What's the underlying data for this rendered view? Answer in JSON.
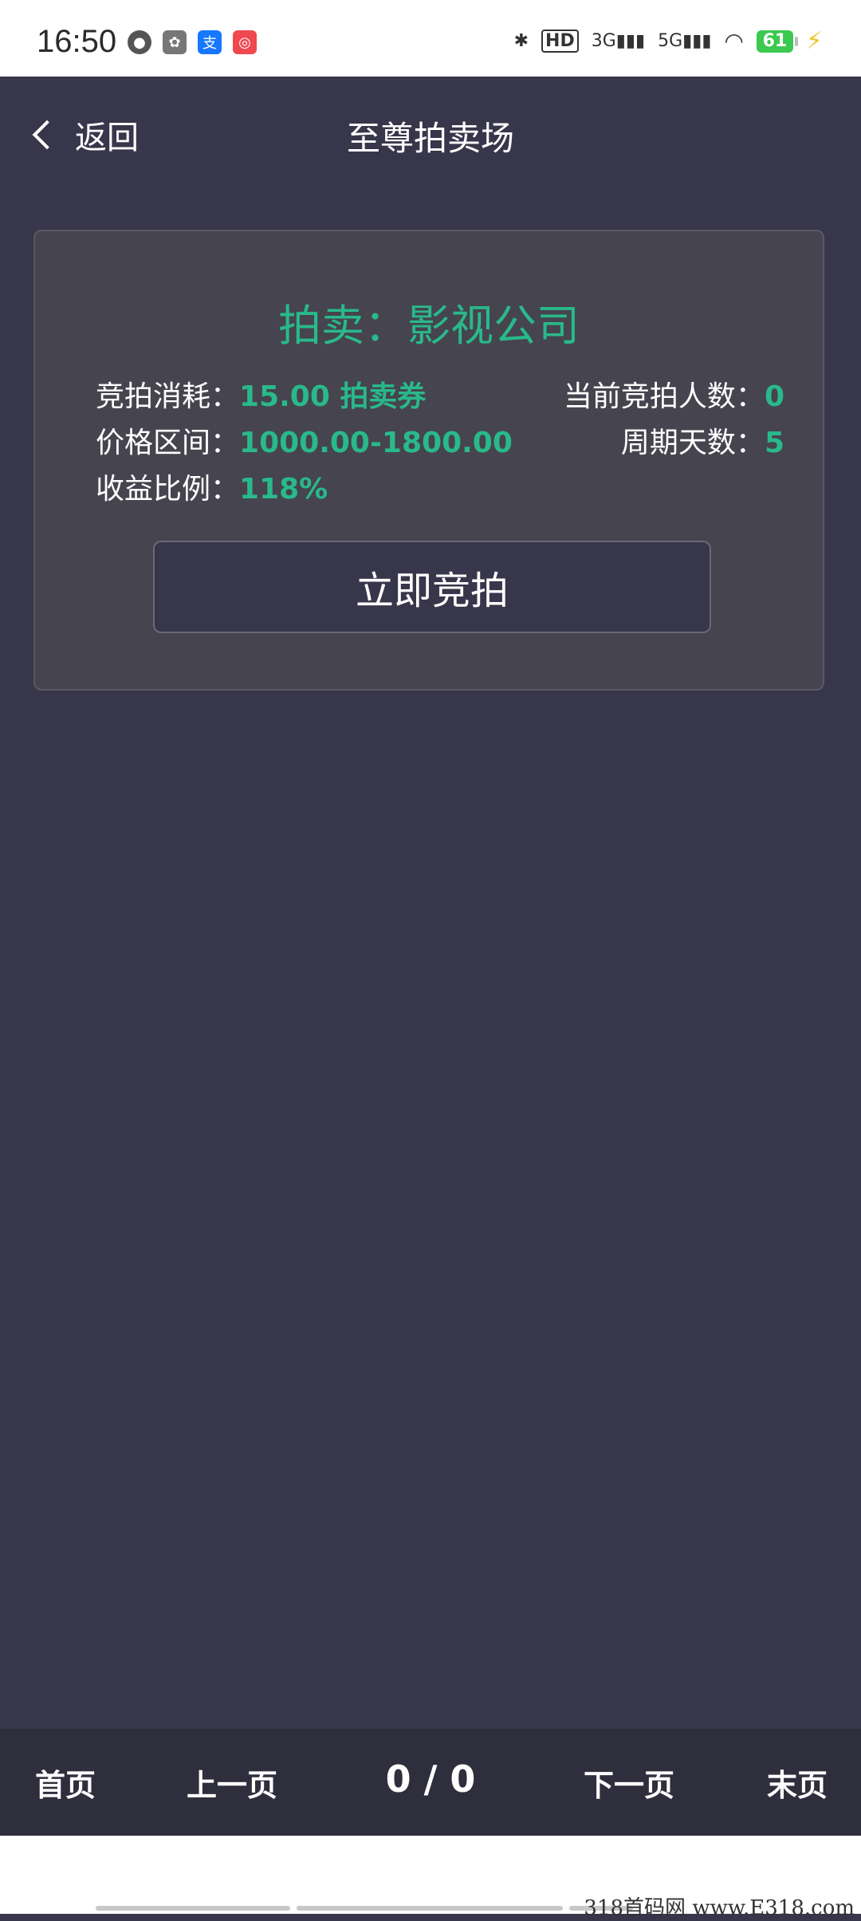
{
  "status_bar": {
    "time": "16:50",
    "battery": "61",
    "network_hd": "HD",
    "net_3g": "3G",
    "net_5g": "5G",
    "app_icons": [
      "robot-icon",
      "squirrel-icon",
      "alipay-icon",
      "app-icon"
    ]
  },
  "nav": {
    "back_label": "返回",
    "title": "至尊拍卖场"
  },
  "card": {
    "title": "拍卖：影视公司",
    "cost_label": "竞拍消耗：",
    "cost_value": "15.00 拍卖券",
    "bidders_label": "当前竞拍人数：",
    "bidders_value": "0",
    "price_label": "价格区间：",
    "price_value": "1000.00-1800.00",
    "days_label": "周期天数：",
    "days_value": "5",
    "ratio_label": "收益比例：",
    "ratio_value": "118%",
    "bid_button": "立即竞拍"
  },
  "pager": {
    "first": "首页",
    "prev": "上一页",
    "count": "0 / 0",
    "next": "下一页",
    "last": "末页"
  },
  "watermark": "318首码网 www.E318.com",
  "colors": {
    "background": "#38364a",
    "accent": "#29b98a",
    "card": "#45444f"
  }
}
